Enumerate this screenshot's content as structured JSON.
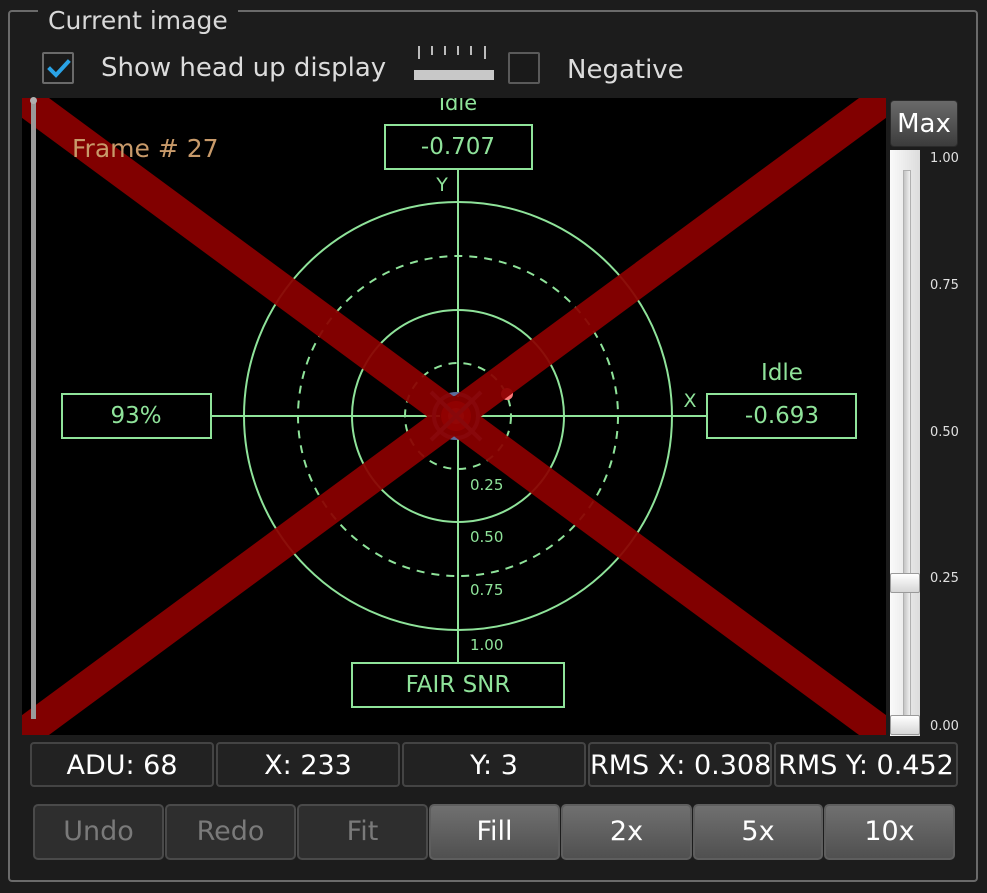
{
  "group": {
    "title": "Current image"
  },
  "options": {
    "show_hud_label": "Show head up display",
    "show_hud_checked": true,
    "negative_label": "Negative",
    "negative_checked": false
  },
  "hud": {
    "frame_label": "Frame # 27",
    "y_status": "Idle",
    "y_value": "-0.707",
    "y_axis_label": "Y",
    "x_status": "Idle",
    "x_value": "-0.693",
    "x_axis_label": "X",
    "percent": "93%",
    "snr": "FAIR SNR",
    "rings": [
      "0.25",
      "0.50",
      "0.75",
      "1.00"
    ],
    "colors": {
      "hud": "#8fe39a",
      "cross": "#8b0000",
      "star": "#e01818"
    }
  },
  "level": {
    "max_label": "Max",
    "scale": [
      "1.00",
      "0.75",
      "0.50",
      "0.25",
      "0.00"
    ],
    "upper": 0.25,
    "lower": 0.0
  },
  "stats": {
    "adu": "ADU: 68",
    "x": "X: 233",
    "y": "Y: 3",
    "rms_x": "RMS X: 0.308",
    "rms_y": "RMS Y: 0.452"
  },
  "buttons": {
    "undo": "Undo",
    "redo": "Redo",
    "fit": "Fit",
    "fill": "Fill",
    "z2": "2x",
    "z5": "5x",
    "z10": "10x"
  }
}
